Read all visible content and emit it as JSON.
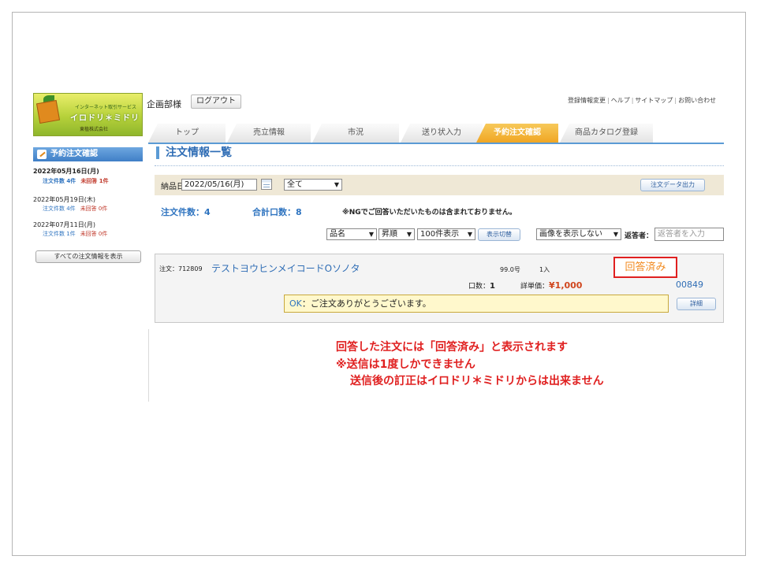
{
  "header": {
    "user_name": "企画部様",
    "logout_label": "ログアウト",
    "links": [
      "登録情報変更",
      "ヘルプ",
      "サイトマップ",
      "お問い合わせ"
    ]
  },
  "logo": {
    "line1": "インターネット取引サービス",
    "line2": "イロドリ＊ミドリ",
    "line3": "東植株式会社"
  },
  "tabs": [
    {
      "label": "トップ",
      "active": false
    },
    {
      "label": "売立情報",
      "active": false
    },
    {
      "label": "市況",
      "active": false
    },
    {
      "label": "送り状入力",
      "active": false
    },
    {
      "label": "予約注文確認",
      "active": true
    },
    {
      "label": "商品カタログ登録",
      "active": false
    }
  ],
  "sidebar": {
    "title": "予約注文確認",
    "entries": [
      {
        "date": "2022年05月16日(月)",
        "count_text": "注文件数 4件",
        "unanswered_text": "未回答 1件",
        "bold": true
      },
      {
        "date": "2022年05月19日(木)",
        "count_text": "注文件数 4件",
        "unanswered_text": "未回答 0件",
        "bold": false
      },
      {
        "date": "2022年07月11日(月)",
        "count_text": "注文件数 1件",
        "unanswered_text": "未回答 0件",
        "bold": false
      }
    ],
    "show_all_label": "すべての注文情報を表示"
  },
  "main": {
    "title": "注文情報一覧",
    "filter": {
      "date_label": "納品日",
      "date_value": "2022/05/16(月)",
      "scope_value": "全て",
      "export_label": "注文データ出力"
    },
    "summary": {
      "order_count": "注文件数：4",
      "total_units": "合計口数：8",
      "note": "※NGでご回答いただいたものは含まれておりません。"
    },
    "sort": {
      "field": "品名",
      "order": "昇順",
      "per_page": "100件表示",
      "switch_label": "表示切替",
      "image_mode": "画像を表示しない",
      "responder_label": "返答者：",
      "responder_placeholder": "返答者を入力"
    },
    "order": {
      "order_no": "注文：712809",
      "product_name": "テストヨウヒンメイコードOソノタ",
      "size": "99.0号",
      "pack": "1入",
      "status": "回答済み",
      "units_label": "口数：",
      "units_value": "1",
      "price_label": "詳単価：",
      "price_value": "¥1,000",
      "code": "00849",
      "reply_ok": "OK",
      "reply_text": "：ご注文ありがとうございます。",
      "detail_label": "詳細"
    }
  },
  "annotation": {
    "line1": "回答した注文には「回答済み」と表示されます",
    "line2": "※送信は1度しかできません",
    "line3": "送信後の訂正はイロドリ＊ミドリからは出来ません"
  },
  "colors": {
    "accent_blue": "#2f6db5",
    "tab_active": "#f0a623",
    "highlight_red": "#e02020"
  }
}
